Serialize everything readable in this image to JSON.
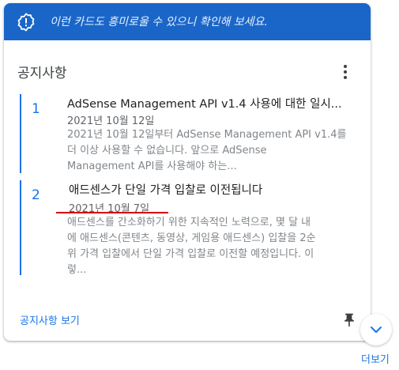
{
  "banner": {
    "text": "이런 카드도 흥미로울 수 있으니 확인해 보세요.",
    "icon": "alert-badge-icon"
  },
  "card": {
    "title": "공지사항",
    "menu_icon": "more-vert-icon"
  },
  "items": [
    {
      "number": "1",
      "title": "AdSense Management API v1.4 사용에 대한 일시...",
      "date": "2021년 10월 12일",
      "body_lines": [
        "2021년 10월 12일부터 AdSense Management API v1.4를",
        "더 이상 사용할 수 없습니다. 앞으로 AdSense",
        "Management API를 사용해야 하는..."
      ]
    },
    {
      "number": "2",
      "title": "애드센스가 단일 가격 입찰로 이전됩니다",
      "date": "2021년 10월 7일",
      "body_lines": [
        "애드센스를 간소화하기 위한 지속적인 노력으로, 몇 달 내",
        "에 애드센스(콘텐츠, 동영상, 게임용 애드센스) 입찰을 2순",
        "위 가격 입찰에서 단일 가격 입찰로 이전할 예정입니다. 이",
        "렇..."
      ]
    }
  ],
  "footer": {
    "link": "공지사항 보기",
    "pin_icon": "pin-icon"
  },
  "more": {
    "label": "더보기",
    "icon": "chevron-down-icon"
  },
  "colors": {
    "banner": "#1a66c8",
    "accent": "#1a73e8",
    "underline": "#d50000"
  }
}
